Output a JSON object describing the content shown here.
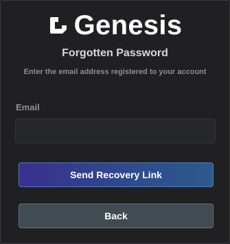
{
  "brand": {
    "name": "Genesis",
    "logo_icon": "genesis-logo-icon"
  },
  "form": {
    "title": "Forgotten Password",
    "subtitle": "Enter the email address registered to your account",
    "email_label": "Email",
    "email_value": "",
    "email_placeholder": ""
  },
  "actions": {
    "send_label": "Send Recovery Link",
    "back_label": "Back"
  },
  "colors": {
    "background": "#202023",
    "send_button_start": "#3a2f8f",
    "send_button_end": "#2b5a8c",
    "back_button": "#414b52"
  }
}
